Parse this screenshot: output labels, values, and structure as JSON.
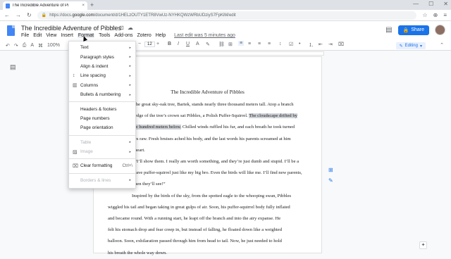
{
  "browser": {
    "tab_title": "The Incredible Adventure of Pi",
    "tab_close": "×",
    "new_tab": "+",
    "url_prefix": "https://docs.",
    "url_domain": "google.com",
    "url_path": "/document/d/1HELzOUTY1ETR8VwUz-NYHKQWzWRbUDziyS7FpKiM/edit",
    "win_controls": [
      "—",
      "☐",
      "✕"
    ]
  },
  "docs": {
    "title": "The Incredible Adventure of Pibbles",
    "title_icons": [
      "☆",
      "⊡",
      "☁"
    ],
    "menus": [
      "File",
      "Edit",
      "View",
      "Insert",
      "Format",
      "Tools",
      "Add-ons",
      "Zotero",
      "Help"
    ],
    "last_edit": "Last edit was 5 minutes ago",
    "share_label": "Share",
    "share_icon": "🔒"
  },
  "toolbar": {
    "zoom": "100%",
    "font_size": "12",
    "editing_label": "Editing",
    "editing_icon": "✎"
  },
  "format_menu": {
    "items": [
      {
        "label": "Text",
        "icon": "",
        "arrow": "▸",
        "shortcut": "",
        "disabled": false
      },
      {
        "label": "Paragraph styles",
        "icon": "",
        "arrow": "▸",
        "shortcut": "",
        "disabled": false
      },
      {
        "label": "Align & indent",
        "icon": "",
        "arrow": "▸",
        "shortcut": "",
        "disabled": false
      },
      {
        "label": "Line spacing",
        "icon": "↕",
        "arrow": "▸",
        "shortcut": "",
        "disabled": false
      },
      {
        "label": "Columns",
        "icon": "▥",
        "arrow": "▸",
        "shortcut": "",
        "disabled": false
      },
      {
        "label": "Bullets & numbering",
        "icon": "",
        "arrow": "▸",
        "shortcut": "",
        "disabled": false
      },
      {
        "sep": true
      },
      {
        "label": "Headers & footers",
        "icon": "",
        "arrow": "",
        "shortcut": "",
        "disabled": false
      },
      {
        "label": "Page numbers",
        "icon": "",
        "arrow": "",
        "shortcut": "",
        "disabled": false
      },
      {
        "label": "Page orientation",
        "icon": "",
        "arrow": "",
        "shortcut": "",
        "disabled": false
      },
      {
        "sep": true
      },
      {
        "label": "Table",
        "icon": "",
        "arrow": "▸",
        "shortcut": "",
        "disabled": true
      },
      {
        "label": "Image",
        "icon": "▨",
        "arrow": "▸",
        "shortcut": "",
        "disabled": true
      },
      {
        "sep": true
      },
      {
        "label": "Clear formatting",
        "icon": "⌧",
        "arrow": "",
        "shortcut": "Ctrl+\\",
        "disabled": false
      },
      {
        "sep": true
      },
      {
        "label": "Borders & lines",
        "icon": "",
        "arrow": "▸",
        "shortcut": "",
        "disabled": true
      }
    ]
  },
  "document": {
    "heading": "The Incredible Adventure of Pibbles",
    "lines": [
      {
        "text": "the great sky-oak tree, Bartek, stands nearly three thousand meters tall. Atop a branch",
        "hl": ""
      },
      {
        "text": "edge of the tree’s crown sat Pibbles, a Polish Puffer-Squirrel. ",
        "hl": "The cloudscape drifted by"
      },
      {
        "pre": "w hundred meters below.",
        "text": " Chilled winds ruffled his fur, and each breath he took turned",
        "hl": ""
      },
      {
        "text": "es raw. Fresh bruises ached his body, and the last words his parents screamed at him",
        "hl": ""
      },
      {
        "text": "heart.",
        "hl": ""
      },
      {
        "text": "“I’ll show them. I really am worth something, and they’re just dumb and stupid. I’ll be a",
        "hl": ""
      },
      {
        "text": "rave puffer-squirrel just like my big bro. Even the birds will like me. I’ll find new parents,",
        "hl": ""
      },
      {
        "text": "hen they’ll see!”",
        "hl": ""
      },
      {
        "text": "Inspired by the birds of the sky, from the spotted eagle to the whooping swan, Pibbles",
        "hl": "",
        "indent": true
      },
      {
        "text": "wiggled his tail and began taking in great gulps of air. Soon, his puffer-squirrel body fully inflated",
        "hl": ""
      },
      {
        "text": "and became round. With a running start, he leapt off the branch and into the airy expanse. He",
        "hl": ""
      },
      {
        "text": "felt his stomach drop and fear creep in, but instead of falling, he floated down like a weighted",
        "hl": ""
      },
      {
        "text": "balloon. Soon, exhilaration passed through him from head to tail. Now, he just needed to hold",
        "hl": ""
      },
      {
        "text": "his breath the whole way down.",
        "hl": ""
      }
    ]
  }
}
